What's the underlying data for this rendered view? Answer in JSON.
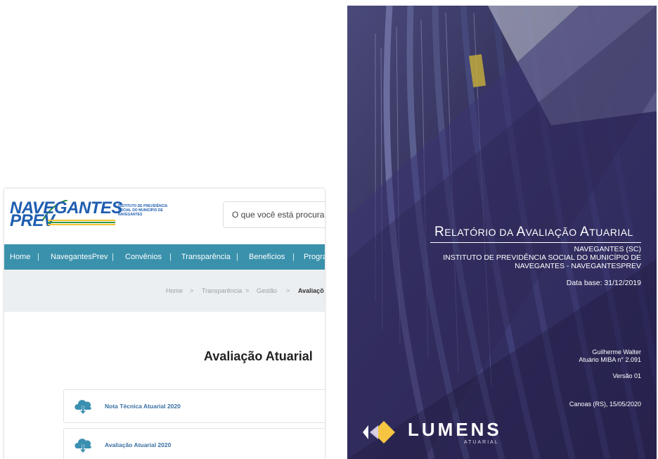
{
  "site": {
    "logo": {
      "line1": "NAVEGANTES",
      "line2": "PREV",
      "tagline": "INSTITUTO DE PREVIDÊNCIA SOCIAL DO MUNICÍPIO DE NAVEGANTES"
    },
    "search": {
      "placeholder": "O que você está procurando?"
    },
    "nav": {
      "items": [
        "Home",
        "NavegantesPrev",
        "Convênios",
        "Transparência",
        "Benefícios",
        "Progra"
      ],
      "separator": "|"
    },
    "breadcrumb": {
      "items": [
        "Home",
        "Transparência",
        "Gestão",
        "Avaliaçõ"
      ],
      "separator": ">"
    },
    "page_title": "Avaliação Atuarial",
    "documents": [
      {
        "label": "Nota Técnica Atuarial 2020",
        "icon": "cloud-download-icon"
      },
      {
        "label": "Avaliação Atuarial 2020",
        "icon": "cloud-download-icon"
      }
    ],
    "colors": {
      "nav": "#3a91ac",
      "brand_blue": "#1e5db0",
      "link": "#3a6fa3",
      "crumb_bg": "#eceff1"
    }
  },
  "cover": {
    "title": {
      "big1": "R",
      "small1": "ELATÓRIO DA ",
      "big2": "A",
      "small2": "VALIAÇÃO ",
      "big3": "A",
      "small3": "TUARIAL"
    },
    "entity": [
      "NAVEGANTES (SC)",
      "INSTITUTO DE PREVIDÊNCIA SOCIAL DO MUNICÍPIO DE",
      "NAVEGANTES - NAVEGANTESPREV"
    ],
    "data_base": "Data base: 31/12/2019",
    "author": [
      "Guilherme Walter",
      "Atuário MIBA n° 2.091"
    ],
    "version": "Versão 01",
    "place_date": "Canoas (RS), 15/05/2020",
    "brand": {
      "name": "LUMENS",
      "sub": "ATUARIAL"
    },
    "colors": {
      "overlay": "#3b3572",
      "logo_yellow": "#f5c542"
    }
  }
}
